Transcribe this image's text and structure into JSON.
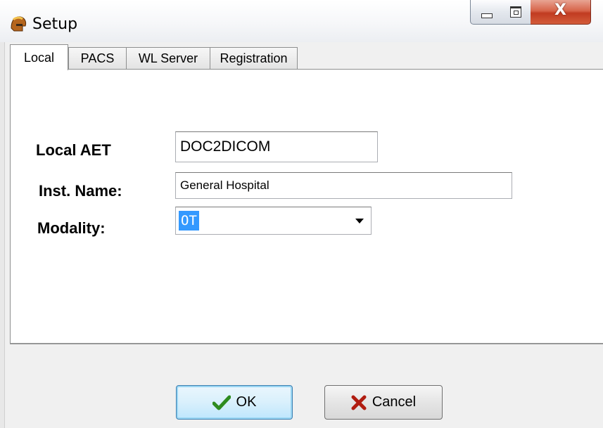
{
  "window": {
    "title": "Setup",
    "icons": {
      "app": "helmet-icon",
      "minimize": "minimize-icon",
      "maximize": "maximize-icon",
      "close": "close-icon"
    },
    "close_glyph": "X"
  },
  "tabs": [
    {
      "label": "Local",
      "active": true
    },
    {
      "label": "PACS",
      "active": false
    },
    {
      "label": "WL Server",
      "active": false
    },
    {
      "label": "Registration",
      "active": false
    }
  ],
  "form": {
    "local_aet": {
      "label": "Local AET",
      "value": "DOC2DICOM"
    },
    "inst_name": {
      "label": "Inst. Name:",
      "value": "General Hospital"
    },
    "modality": {
      "label": "Modality:",
      "value": "OT"
    }
  },
  "buttons": {
    "ok": {
      "label": "OK",
      "icon": "checkmark-icon"
    },
    "cancel": {
      "label": "Cancel",
      "icon": "x-mark-icon"
    }
  },
  "colors": {
    "selection": "#3399ff",
    "close_button": "#c13b21",
    "check": "#2e8b1e",
    "x_mark": "#b01c10"
  }
}
